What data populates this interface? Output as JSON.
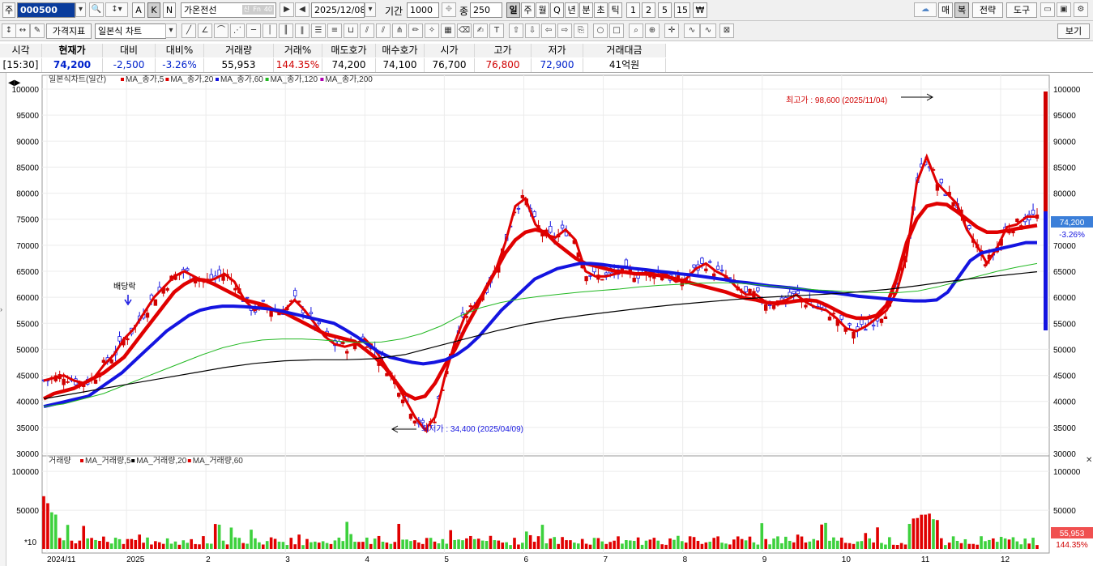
{
  "toolbar1": {
    "market_btn": "주",
    "code": "000500",
    "btn_a": "A",
    "btn_k": "K",
    "btn_n": "N",
    "name": "가온전선",
    "name_tags": [
      "신",
      "Fn",
      "40"
    ],
    "date": "2025/12/08",
    "period_label": "기간",
    "period": "1000",
    "count_label": "종",
    "count": "250",
    "periods": [
      "일",
      "주",
      "월",
      "Q",
      "년",
      "분",
      "초",
      "틱",
      "1",
      "2",
      "5",
      "15"
    ],
    "won_icon": "₩",
    "right_btns": [
      "매",
      "복",
      "전략",
      "도구"
    ]
  },
  "toolbar2": {
    "indicator_btn": "가격지표",
    "chart_type": "일본식 차트",
    "view_btn": "보기"
  },
  "quote": {
    "headers": [
      "시각",
      "현재가",
      "대비",
      "대비%",
      "거래량",
      "거래%",
      "매도호가",
      "매수호가",
      "시가",
      "고가",
      "저가",
      "거래대금"
    ],
    "values": [
      "[15:30]",
      "74,200",
      "-2,500",
      "-3.26%",
      "55,953",
      "144.35%",
      "74,200",
      "74,100",
      "76,700",
      "76,800",
      "72,900",
      "41억원"
    ]
  },
  "price_legend": {
    "title": "일본식차트(일간)",
    "items": [
      {
        "label": "MA_종가,5",
        "color": "#e00000"
      },
      {
        "label": "MA_종가,20",
        "color": "#e00000"
      },
      {
        "label": "MA_종가,60",
        "color": "#1414e0"
      },
      {
        "label": "MA_종가,120",
        "color": "#22b822"
      },
      {
        "label": "MA_종가,200",
        "color": "#b000b0"
      }
    ]
  },
  "volume_legend": {
    "title": "거래량",
    "items": [
      {
        "label": "MA_거래량,5",
        "color": "#e00000"
      },
      {
        "label": "MA_거래량,20",
        "color": "#000000"
      },
      {
        "label": "MA_거래량,60",
        "color": "#e00000"
      }
    ]
  },
  "annotations": {
    "dividend": "배당락",
    "high": "최고가 : 98,600 (2025/11/04)",
    "low": "최저가 : 34,400 (2025/04/09)"
  },
  "price_tags": {
    "current": "74,200",
    "change": "-3.26%"
  },
  "volume_tags": {
    "current": "55,953",
    "pct": "144.35%",
    "unit": "*10"
  },
  "chart_data": {
    "type": "line",
    "price_axis": {
      "min": 30000,
      "max": 100000,
      "ticks": [
        "100000",
        "95000",
        "90000",
        "85000",
        "80000",
        "75000",
        "70000",
        "65000",
        "60000",
        "55000",
        "50000",
        "45000",
        "40000",
        "35000",
        "30000"
      ]
    },
    "volume_axis": {
      "ticks": [
        "100000",
        "50000"
      ]
    },
    "x_labels": [
      "2024/11",
      "2025",
      "2",
      "3",
      "4",
      "5",
      "6",
      "7",
      "8",
      "9",
      "10",
      "11",
      "12"
    ],
    "series": [
      {
        "name": "MA_종가,5",
        "values": [
          44000,
          44500,
          45000,
          44000,
          43500,
          44500,
          47000,
          49000,
          52000,
          54000,
          57000,
          60000,
          62000,
          64000,
          65000,
          64000,
          63000,
          63500,
          64500,
          63000,
          59500,
          57500,
          58500,
          57500,
          57500,
          59500,
          57500,
          55000,
          52500,
          51000,
          50500,
          51000,
          52000,
          50000,
          47000,
          44000,
          40500,
          37000,
          34500,
          37000,
          45000,
          51500,
          56500,
          58500,
          61500,
          65000,
          70500,
          77500,
          79000,
          74000,
          72000,
          71500,
          73000,
          71000,
          65000,
          64000,
          64000,
          64500,
          65000,
          64500,
          64500,
          65000,
          64500,
          63000,
          63500,
          65500,
          66500,
          65000,
          64000,
          62000,
          60500,
          60500,
          59000,
          59000,
          59500,
          60500,
          59000,
          58000,
          57500,
          56000,
          54000,
          53500,
          54500,
          56000,
          57500,
          61000,
          68000,
          82000,
          87000,
          82000,
          80000,
          78000,
          73000,
          70000,
          66500,
          69500,
          73500,
          74000,
          75500,
          75500
        ]
      },
      {
        "name": "MA_종가,20",
        "values": [
          40500,
          41500,
          42000,
          42500,
          43500,
          44500,
          45500,
          47000,
          48500,
          51000,
          53500,
          56000,
          58500,
          61000,
          62500,
          63500,
          63300,
          62500,
          61500,
          60500,
          59500,
          59000,
          58500,
          57500,
          57000,
          56000,
          55000,
          54000,
          53000,
          52500,
          52000,
          51500,
          50000,
          48500,
          46500,
          44000,
          41500,
          40500,
          41000,
          43500,
          47000,
          50000,
          54000,
          57500,
          61500,
          65000,
          68500,
          71000,
          72500,
          73000,
          72500,
          70500,
          69000,
          67500,
          66500,
          66000,
          65500,
          65000,
          64800,
          64500,
          64500,
          64300,
          64000,
          63500,
          63000,
          62500,
          62000,
          61500,
          61000,
          60300,
          59800,
          59500,
          59000,
          58800,
          59000,
          59300,
          59500,
          59300,
          58500,
          57500,
          56500,
          56000,
          56000,
          56500,
          58500,
          63500,
          70500,
          75000,
          77500,
          78000,
          77800,
          76500,
          75000,
          73500,
          72500,
          72500,
          72800,
          73200,
          73500,
          73800
        ]
      },
      {
        "name": "MA_종가,60",
        "values": [
          39000,
          39500,
          40000,
          40500,
          41000,
          42500,
          44000,
          45500,
          47500,
          49500,
          51500,
          53500,
          55000,
          56500,
          57500,
          58000,
          58300,
          58300,
          58200,
          58000,
          57800,
          57500,
          57000,
          56500,
          56000,
          55500,
          55000,
          53800,
          52500,
          51000,
          49500,
          48500,
          48000,
          47500,
          47200,
          47500,
          48000,
          49000,
          50500,
          52500,
          55000,
          57500,
          59500,
          61500,
          63500,
          64500,
          65500,
          66000,
          66500,
          66500,
          66300,
          66000,
          65800,
          65500,
          65300,
          65000,
          64800,
          64500,
          64300,
          64000,
          63700,
          63400,
          63000,
          62800,
          62500,
          62200,
          62000,
          61800,
          61500,
          61200,
          61000,
          60800,
          60500,
          60200,
          60000,
          59800,
          59600,
          59400,
          59300,
          59300,
          59500,
          61000,
          64000,
          67000,
          68500,
          69000,
          69500,
          70000,
          70500,
          70500
        ]
      },
      {
        "name": "MA_종가,120",
        "values": [
          39000,
          39500,
          40500,
          41500,
          43000,
          44500,
          46000,
          47500,
          49000,
          50300,
          51200,
          51800,
          52000,
          52000,
          51800,
          51500,
          51300,
          51400,
          52000,
          53000,
          54500,
          56500,
          58000,
          59000,
          59700,
          60200,
          60600,
          61000,
          61300,
          61600,
          62000,
          62300,
          62500,
          62700,
          62800,
          62700,
          62400,
          62000,
          61700,
          61400,
          61200,
          61000,
          60900,
          60900,
          61200,
          62000,
          63000,
          64000,
          65000,
          65800,
          66500
        ]
      },
      {
        "name": "MA_종가,200",
        "values": [
          40500,
          41500,
          42500,
          43500,
          44500,
          45500,
          46500,
          47300,
          47800,
          48000,
          48000,
          48200,
          49000,
          50500,
          52000,
          53500,
          54800,
          55800,
          56600,
          57300,
          58000,
          58600,
          59100,
          59600,
          60000,
          60300,
          60600,
          61000,
          61500,
          62200,
          63000,
          63700,
          64300,
          64900
        ]
      }
    ]
  }
}
